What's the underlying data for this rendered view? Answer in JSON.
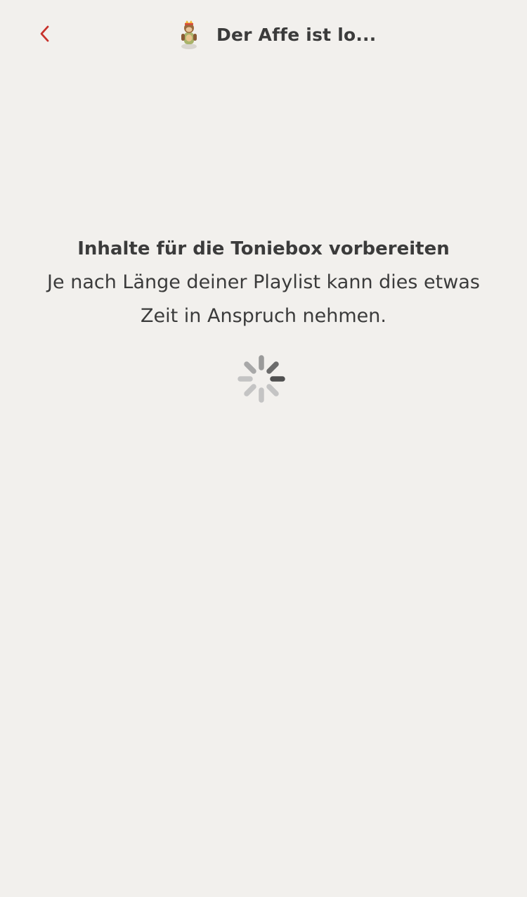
{
  "header": {
    "back_icon": "chevron-left-icon",
    "tonie_icon": "tonie-figure-icon",
    "title": "Der Affe ist lo..."
  },
  "main": {
    "headline": "Inhalte für die Toniebox vorbereiten",
    "subtext": "Je nach Länge deiner Playlist kann dies etwas Zeit in Anspruch nehmen.",
    "spinner_icon": "loading-spinner-icon"
  },
  "colors": {
    "background": "#f2f0ed",
    "accent": "#c8322c",
    "text": "#3b3b3b"
  }
}
